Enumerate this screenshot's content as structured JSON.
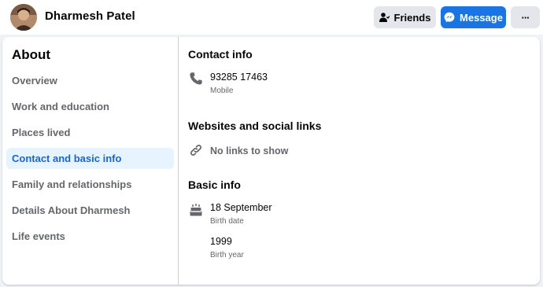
{
  "profile": {
    "name": "Dharmesh Patel"
  },
  "actions": {
    "friends_label": "Friends",
    "message_label": "Message",
    "more_label": "···"
  },
  "colors": {
    "accent_blue": "#1b74e4",
    "active_nav_bg": "#e7f3ff",
    "active_nav_text": "#1b64d6",
    "secondary_text": "#65676b",
    "button_gray": "#e4e6eb"
  },
  "sidebar": {
    "title": "About",
    "items": [
      {
        "label": "Overview"
      },
      {
        "label": "Work and education"
      },
      {
        "label": "Places lived"
      },
      {
        "label": "Contact and basic info",
        "active": true
      },
      {
        "label": "Family and relationships"
      },
      {
        "label": "Details About Dharmesh"
      },
      {
        "label": "Life events"
      }
    ]
  },
  "contact": {
    "title": "Contact info",
    "phone": {
      "icon": "phone-icon",
      "value": "93285 17463",
      "type": "Mobile"
    }
  },
  "websites": {
    "title": "Websites and social links",
    "empty": {
      "icon": "link-icon",
      "text": "No links to show"
    }
  },
  "basic": {
    "title": "Basic info",
    "birth_date": {
      "icon": "birthday-cake-icon",
      "value": "18 September",
      "label": "Birth date"
    },
    "birth_year": {
      "value": "1999",
      "label": "Birth year"
    }
  }
}
